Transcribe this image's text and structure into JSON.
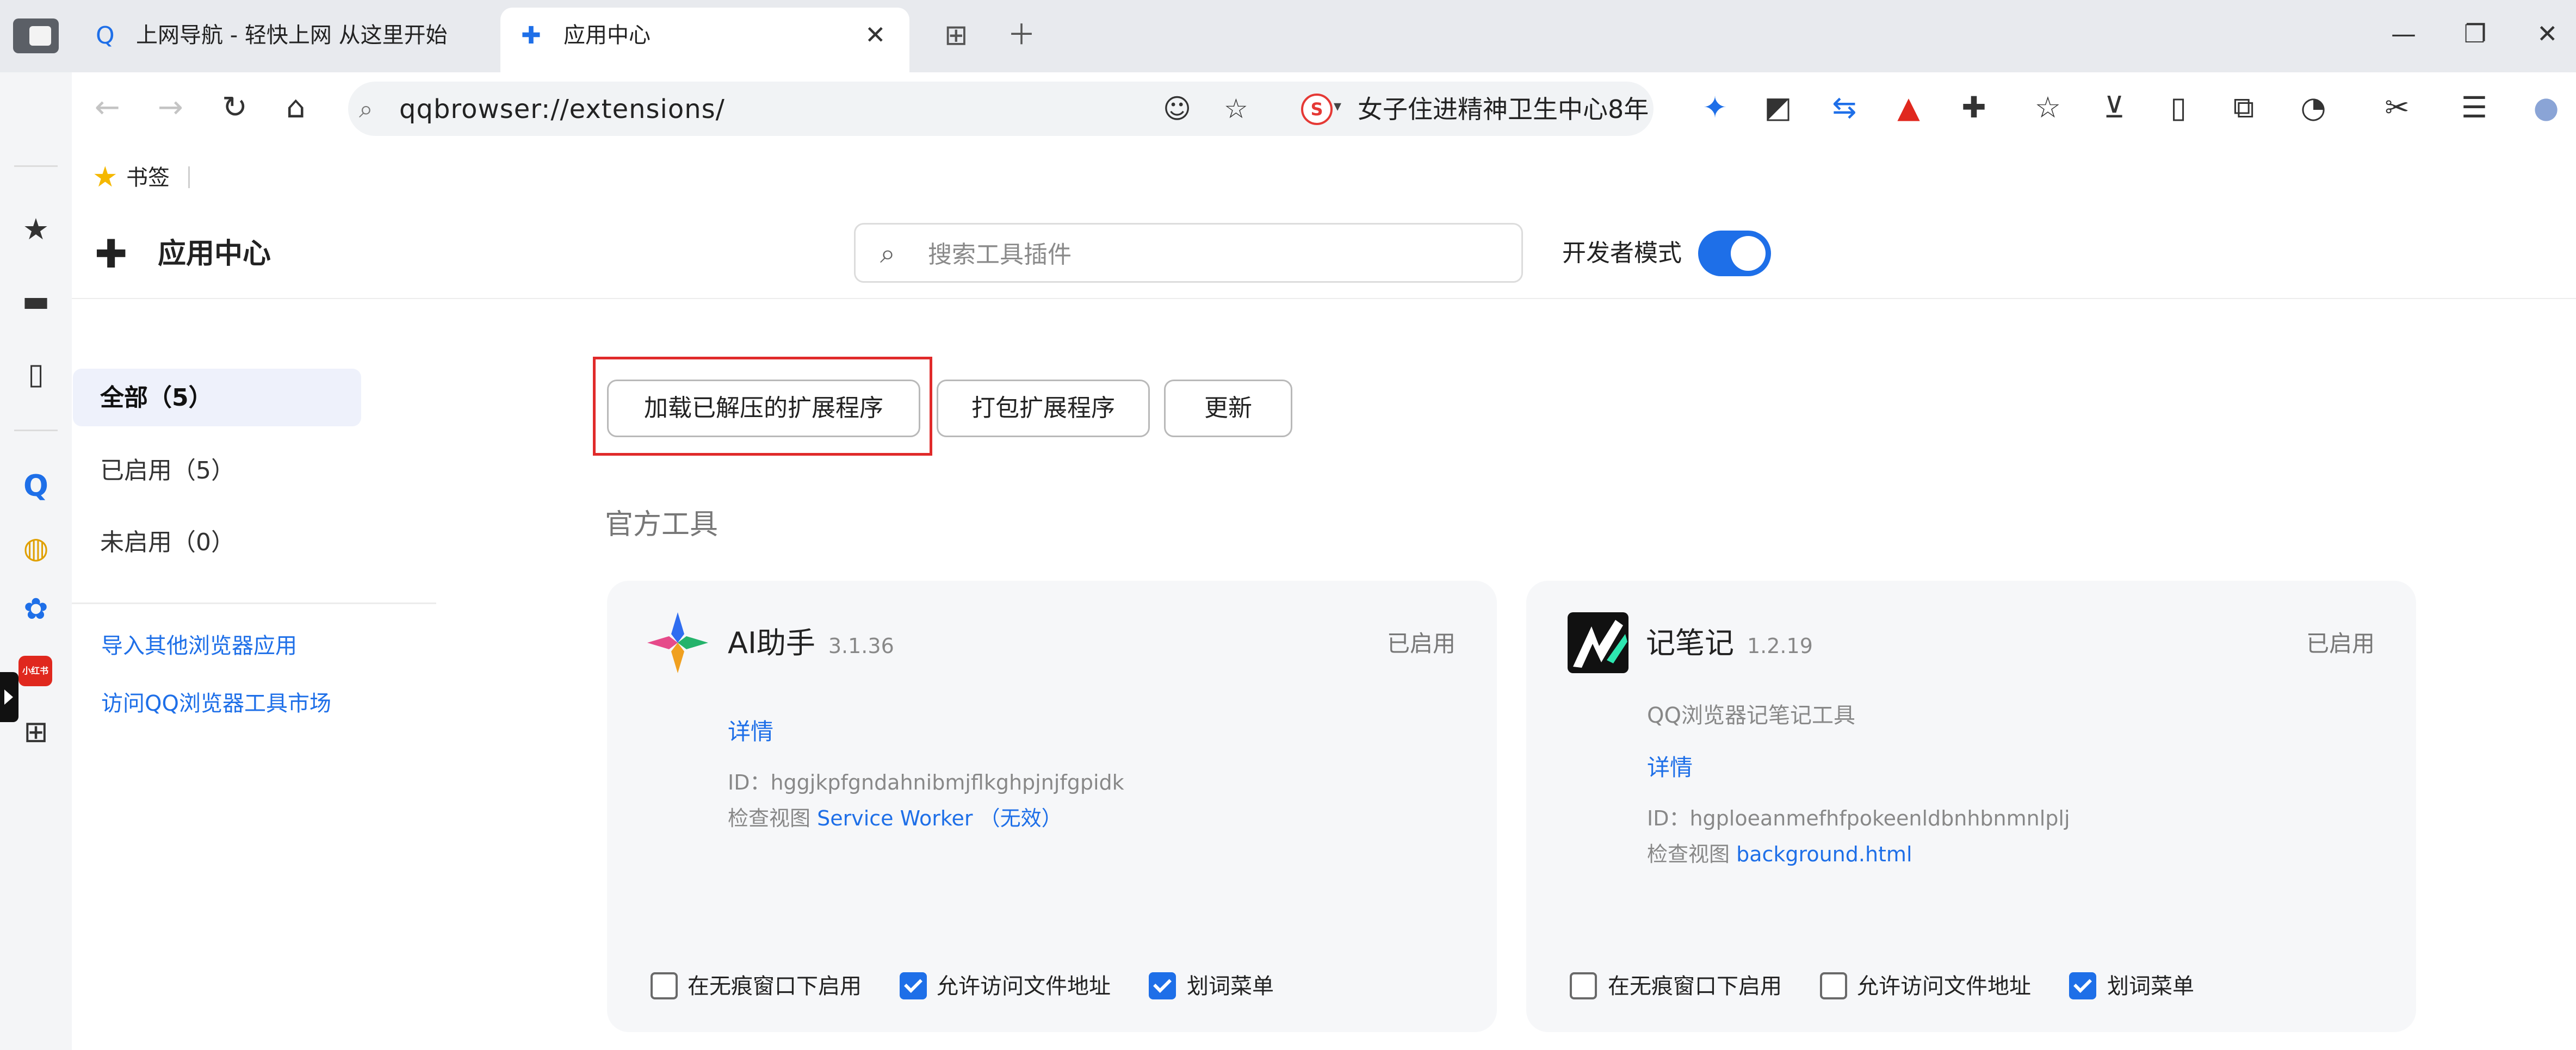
{
  "browser": {
    "tabs": [
      {
        "title": "上网导航 - 轻快上网 从这里开始",
        "icon": "qq-browser-icon"
      },
      {
        "title": "应用中心",
        "icon": "puzzle-icon"
      }
    ],
    "address": "qqbrowser://extensions/",
    "search_suggestion": "女子住进精神卫生中心8年",
    "bookmarks_label": "书签",
    "rail_badge": "小红书"
  },
  "app": {
    "title": "应用中心",
    "search_placeholder": "搜索工具插件",
    "dev_mode_label": "开发者模式",
    "dev_mode_on": true
  },
  "categories": [
    {
      "label": "全部（5）",
      "active": true
    },
    {
      "label": "已启用（5）",
      "active": false
    },
    {
      "label": "未启用（0）",
      "active": false
    }
  ],
  "side_links": [
    "导入其他浏览器应用",
    "访问QQ浏览器工具市场"
  ],
  "actions": {
    "load_unpacked": "加载已解压的扩展程序",
    "pack": "打包扩展程序",
    "update": "更新"
  },
  "section_title": "官方工具",
  "extensions": [
    {
      "name": "AI助手",
      "version": "3.1.36",
      "status": "已启用",
      "details": "详情",
      "id_label": "ID：",
      "id": "hggjkpfgndahnibmjflkghpjnjfgpidk",
      "inspect_label": "检查视图",
      "inspect_link": "Service Worker",
      "inspect_suffix": "（无效）",
      "options": [
        {
          "label": "在无痕窗口下启用",
          "checked": false
        },
        {
          "label": "允许访问文件地址",
          "checked": true
        },
        {
          "label": "划词菜单",
          "checked": true
        }
      ]
    },
    {
      "name": "记笔记",
      "version": "1.2.19",
      "status": "已启用",
      "description": "QQ浏览器记笔记工具",
      "details": "详情",
      "id_label": "ID：",
      "id": "hgploeanmefhfpokeenldbnhbnmnlplj",
      "inspect_label": "检查视图",
      "inspect_link": "background.html",
      "options": [
        {
          "label": "在无痕窗口下启用",
          "checked": false
        },
        {
          "label": "允许访问文件地址",
          "checked": false
        },
        {
          "label": "划词菜单",
          "checked": true
        }
      ]
    }
  ]
}
